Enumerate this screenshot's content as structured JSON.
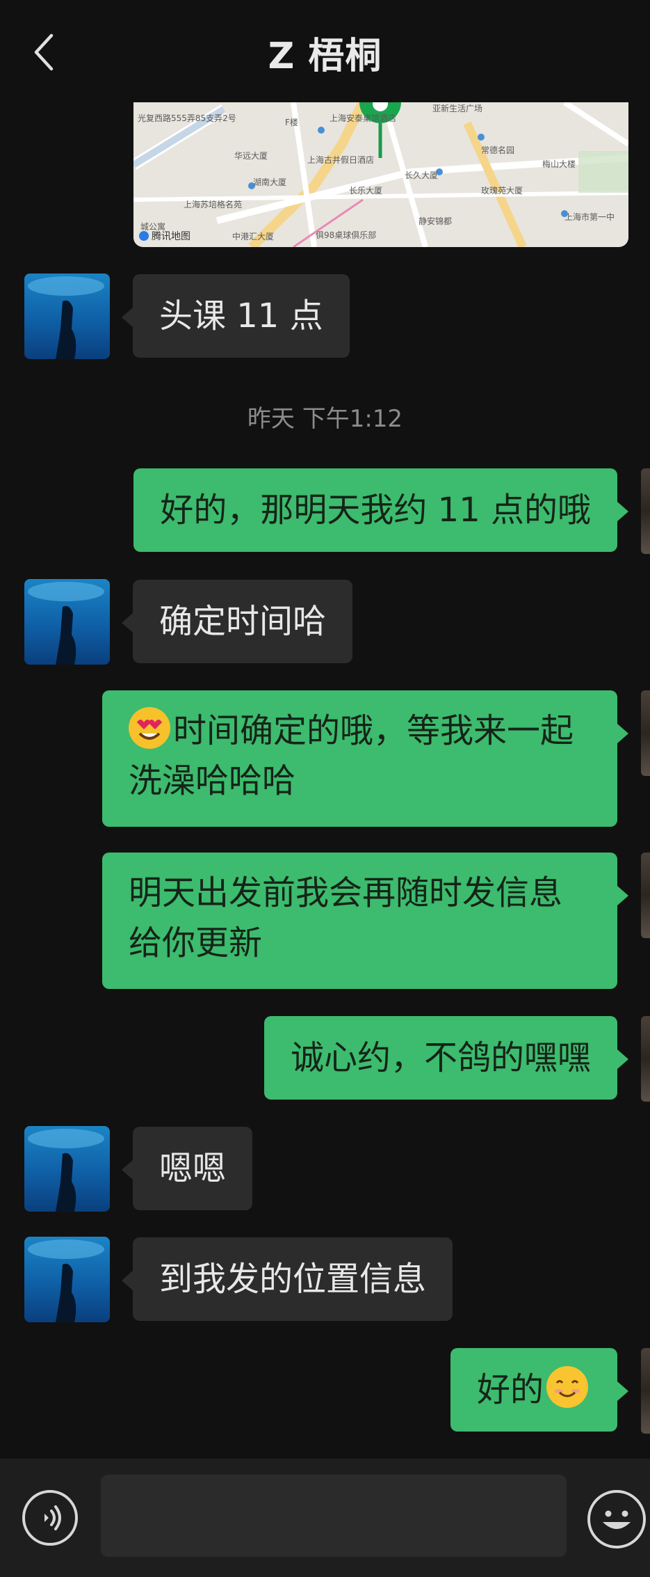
{
  "header": {
    "title": "Z 梧桐"
  },
  "map": {
    "brand": "腾讯地图",
    "labels": [
      "光复西路555弄85支弄2号",
      "F楼",
      "上海安泰桌馆酒店",
      "亚新生活广场",
      "常德名园",
      "梅山大楼",
      "华远大厦",
      "上海古井假日酒店",
      "长久大厦",
      "玫瑰苑大厦",
      "湖南大厦",
      "长乐大厦",
      "上海苏培格名苑",
      "静安锦都",
      "上海市第一中",
      "城公寓",
      "中港汇大厦",
      "俱98桌球俱乐部"
    ]
  },
  "timestamp": "昨天 下午1:12",
  "messages": [
    {
      "side": "left",
      "text": "头课 11 点"
    },
    {
      "side": "right",
      "text": "好的，那明天我约 11 点的哦"
    },
    {
      "side": "left",
      "text": "确定时间哈"
    },
    {
      "side": "right",
      "emoji": "heart-eyes-emoji",
      "text": "时间确定的哦，等我来一起洗澡哈哈哈"
    },
    {
      "side": "right",
      "text": "明天出发前我会再随时发信息给你更新"
    },
    {
      "side": "right",
      "text": "诚心约，不鸽的嘿嘿"
    },
    {
      "side": "left",
      "text": "嗯嗯"
    },
    {
      "side": "left",
      "text": "到我发的位置信息"
    },
    {
      "side": "right",
      "text": "好的",
      "emoji": "smile-emoji"
    }
  ],
  "input": {
    "value": ""
  },
  "colors": {
    "bubble_self": "#3dbb6e",
    "bubble_other": "#2c2c2c",
    "background": "#111111"
  }
}
